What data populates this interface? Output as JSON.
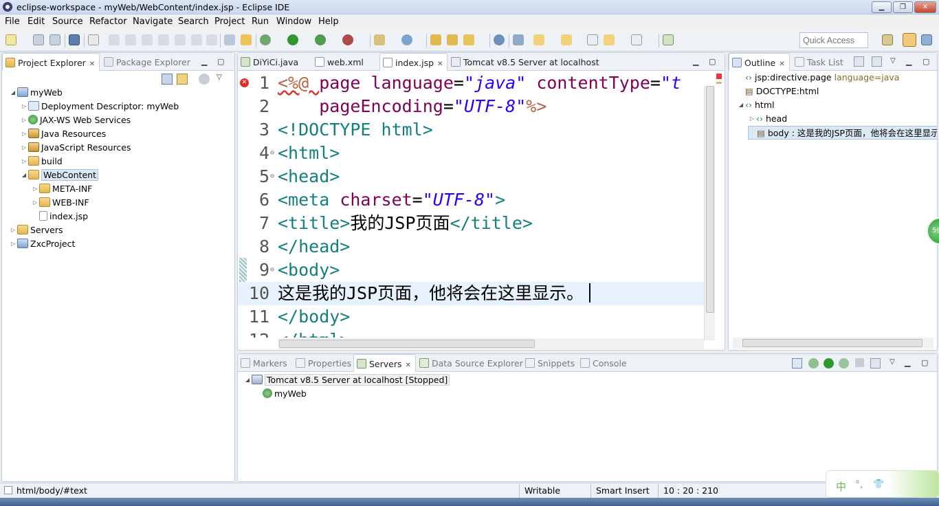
{
  "window": {
    "title": "eclipse-workspace - myWeb/WebContent/index.jsp - Eclipse IDE",
    "controls": [
      "▁",
      "❐",
      "✕"
    ]
  },
  "menu": [
    "File",
    "Edit",
    "Source",
    "Refactor",
    "Navigate",
    "Search",
    "Project",
    "Run",
    "Window",
    "Help"
  ],
  "toolbar": {
    "quick_access_placeholder": "Quick Access"
  },
  "left_panel": {
    "tabs": [
      {
        "label": "Project Explorer",
        "active": true,
        "close": "✕"
      },
      {
        "label": "Package Explorer",
        "active": false
      }
    ],
    "tree": [
      {
        "label": "myWeb",
        "depth": 0,
        "toggle": "◢",
        "icon": "project-icon"
      },
      {
        "label": "Deployment Descriptor: myWeb",
        "depth": 1,
        "toggle": "▷",
        "icon": "descriptor-icon"
      },
      {
        "label": "JAX-WS Web Services",
        "depth": 1,
        "toggle": "▷",
        "icon": "webservice-icon"
      },
      {
        "label": "Java Resources",
        "depth": 1,
        "toggle": "▷",
        "icon": "java-resources-icon"
      },
      {
        "label": "JavaScript Resources",
        "depth": 1,
        "toggle": "▷",
        "icon": "js-resources-icon"
      },
      {
        "label": "build",
        "depth": 1,
        "toggle": "▷",
        "icon": "folder-icon"
      },
      {
        "label": "WebContent",
        "depth": 1,
        "toggle": "◢",
        "icon": "folder-open-icon",
        "selected": true
      },
      {
        "label": "META-INF",
        "depth": 2,
        "toggle": "▷",
        "icon": "folder-icon"
      },
      {
        "label": "WEB-INF",
        "depth": 2,
        "toggle": "▷",
        "icon": "folder-icon"
      },
      {
        "label": "index.jsp",
        "depth": 2,
        "toggle": "",
        "icon": "jsp-file-icon"
      },
      {
        "label": "Servers",
        "depth": 0,
        "toggle": "▷",
        "icon": "folder-icon"
      },
      {
        "label": "ZxcProject",
        "depth": 0,
        "toggle": "▷",
        "icon": "project-icon"
      }
    ]
  },
  "editor": {
    "tabs": [
      {
        "label": "DiYiCi.java",
        "active": false
      },
      {
        "label": "web.xml",
        "active": false
      },
      {
        "label": "index.jsp",
        "active": true,
        "close": "✕"
      },
      {
        "label": "Tomcat v8.5 Server at localhost",
        "active": false
      }
    ],
    "lines": [
      {
        "n": "1",
        "fold": "",
        "parts": [
          [
            "c-dir",
            "<%@ "
          ],
          [
            "c-attr",
            "page "
          ],
          [
            "c-attr",
            "language"
          ],
          [
            "c-txt",
            "="
          ],
          [
            "c-val",
            "\"java\" "
          ],
          [
            "c-attr",
            "contentType"
          ],
          [
            "c-txt",
            "="
          ],
          [
            "c-val",
            "\"t"
          ]
        ]
      },
      {
        "n": "2",
        "fold": "",
        "parts": [
          [
            "c-txt",
            "    "
          ],
          [
            "c-attr",
            "pageEncoding"
          ],
          [
            "c-txt",
            "="
          ],
          [
            "c-val",
            "\"UTF-8\""
          ],
          [
            "c-dir",
            "%>"
          ]
        ]
      },
      {
        "n": "3",
        "fold": "",
        "parts": [
          [
            "c-dec",
            "<!DOCTYPE html>"
          ]
        ]
      },
      {
        "n": "4",
        "fold": "⊖",
        "parts": [
          [
            "c-tag",
            "<html>"
          ]
        ]
      },
      {
        "n": "5",
        "fold": "⊖",
        "parts": [
          [
            "c-tag",
            "<head>"
          ]
        ]
      },
      {
        "n": "6",
        "fold": "",
        "parts": [
          [
            "c-tag",
            "<meta "
          ],
          [
            "c-attr",
            "charset"
          ],
          [
            "c-txt",
            "="
          ],
          [
            "c-val",
            "\"UTF-8\""
          ],
          [
            "c-tag",
            ">"
          ]
        ]
      },
      {
        "n": "7",
        "fold": "",
        "parts": [
          [
            "c-tag",
            "<title>"
          ],
          [
            "c-txt",
            "我的JSP页面"
          ],
          [
            "c-tag",
            "</title>"
          ]
        ]
      },
      {
        "n": "8",
        "fold": "",
        "parts": [
          [
            "c-tag",
            "</head>"
          ]
        ]
      },
      {
        "n": "9",
        "fold": "⊖",
        "parts": [
          [
            "c-tag",
            "<body>"
          ]
        ]
      },
      {
        "n": "10",
        "fold": "",
        "current": true,
        "parts": [
          [
            "c-txt",
            "这是我的JSP页面，他将会在这里显示。"
          ]
        ]
      },
      {
        "n": "11",
        "fold": "",
        "parts": [
          [
            "c-tag",
            "</body>"
          ]
        ]
      },
      {
        "n": "12",
        "fold": "",
        "parts": [
          [
            "c-tag",
            "</html>"
          ]
        ]
      }
    ]
  },
  "outline": {
    "tabs": [
      {
        "label": "Outline",
        "active": true,
        "close": "✕"
      },
      {
        "label": "Task List",
        "active": false
      }
    ],
    "items": [
      {
        "label": "jsp:directive.page",
        "extra": "language=java",
        "depth": 0,
        "toggle": "",
        "icon": "‹›"
      },
      {
        "label": "DOCTYPE:html",
        "extra": "",
        "depth": 0,
        "toggle": "",
        "icon": "▤"
      },
      {
        "label": "html",
        "extra": "",
        "depth": 0,
        "toggle": "◢",
        "icon": "‹›"
      },
      {
        "label": "head",
        "extra": "",
        "depth": 1,
        "toggle": "▷",
        "icon": "‹›"
      },
      {
        "label": "body : 这是我的JSP页面，他将会在这里显示。",
        "extra": "",
        "depth": 1,
        "toggle": "",
        "icon": "▤",
        "selected": true
      }
    ]
  },
  "bottom_panel": {
    "tabs": [
      {
        "label": "Markers",
        "active": false
      },
      {
        "label": "Properties",
        "active": false
      },
      {
        "label": "Servers",
        "active": true,
        "close": "✕"
      },
      {
        "label": "Data Source Explorer",
        "active": false
      },
      {
        "label": "Snippets",
        "active": false
      },
      {
        "label": "Console",
        "active": false
      }
    ],
    "servers": [
      {
        "label": "Tomcat v8.5 Server at localhost  [Stopped]",
        "depth": 0,
        "toggle": "◢"
      },
      {
        "label": "myWeb",
        "depth": 1,
        "toggle": ""
      }
    ]
  },
  "status": {
    "path": "html/body/#text",
    "mode": "Writable",
    "insert": "Smart Insert",
    "position": "10 : 20 : 210",
    "ime": [
      "中",
      "°,",
      "👕"
    ]
  },
  "colors": {
    "accent": "#4a7bbd",
    "tag": "#137f7f",
    "attr": "#7f0055",
    "value": "#2a00ff",
    "directive": "#bf5f3f"
  }
}
